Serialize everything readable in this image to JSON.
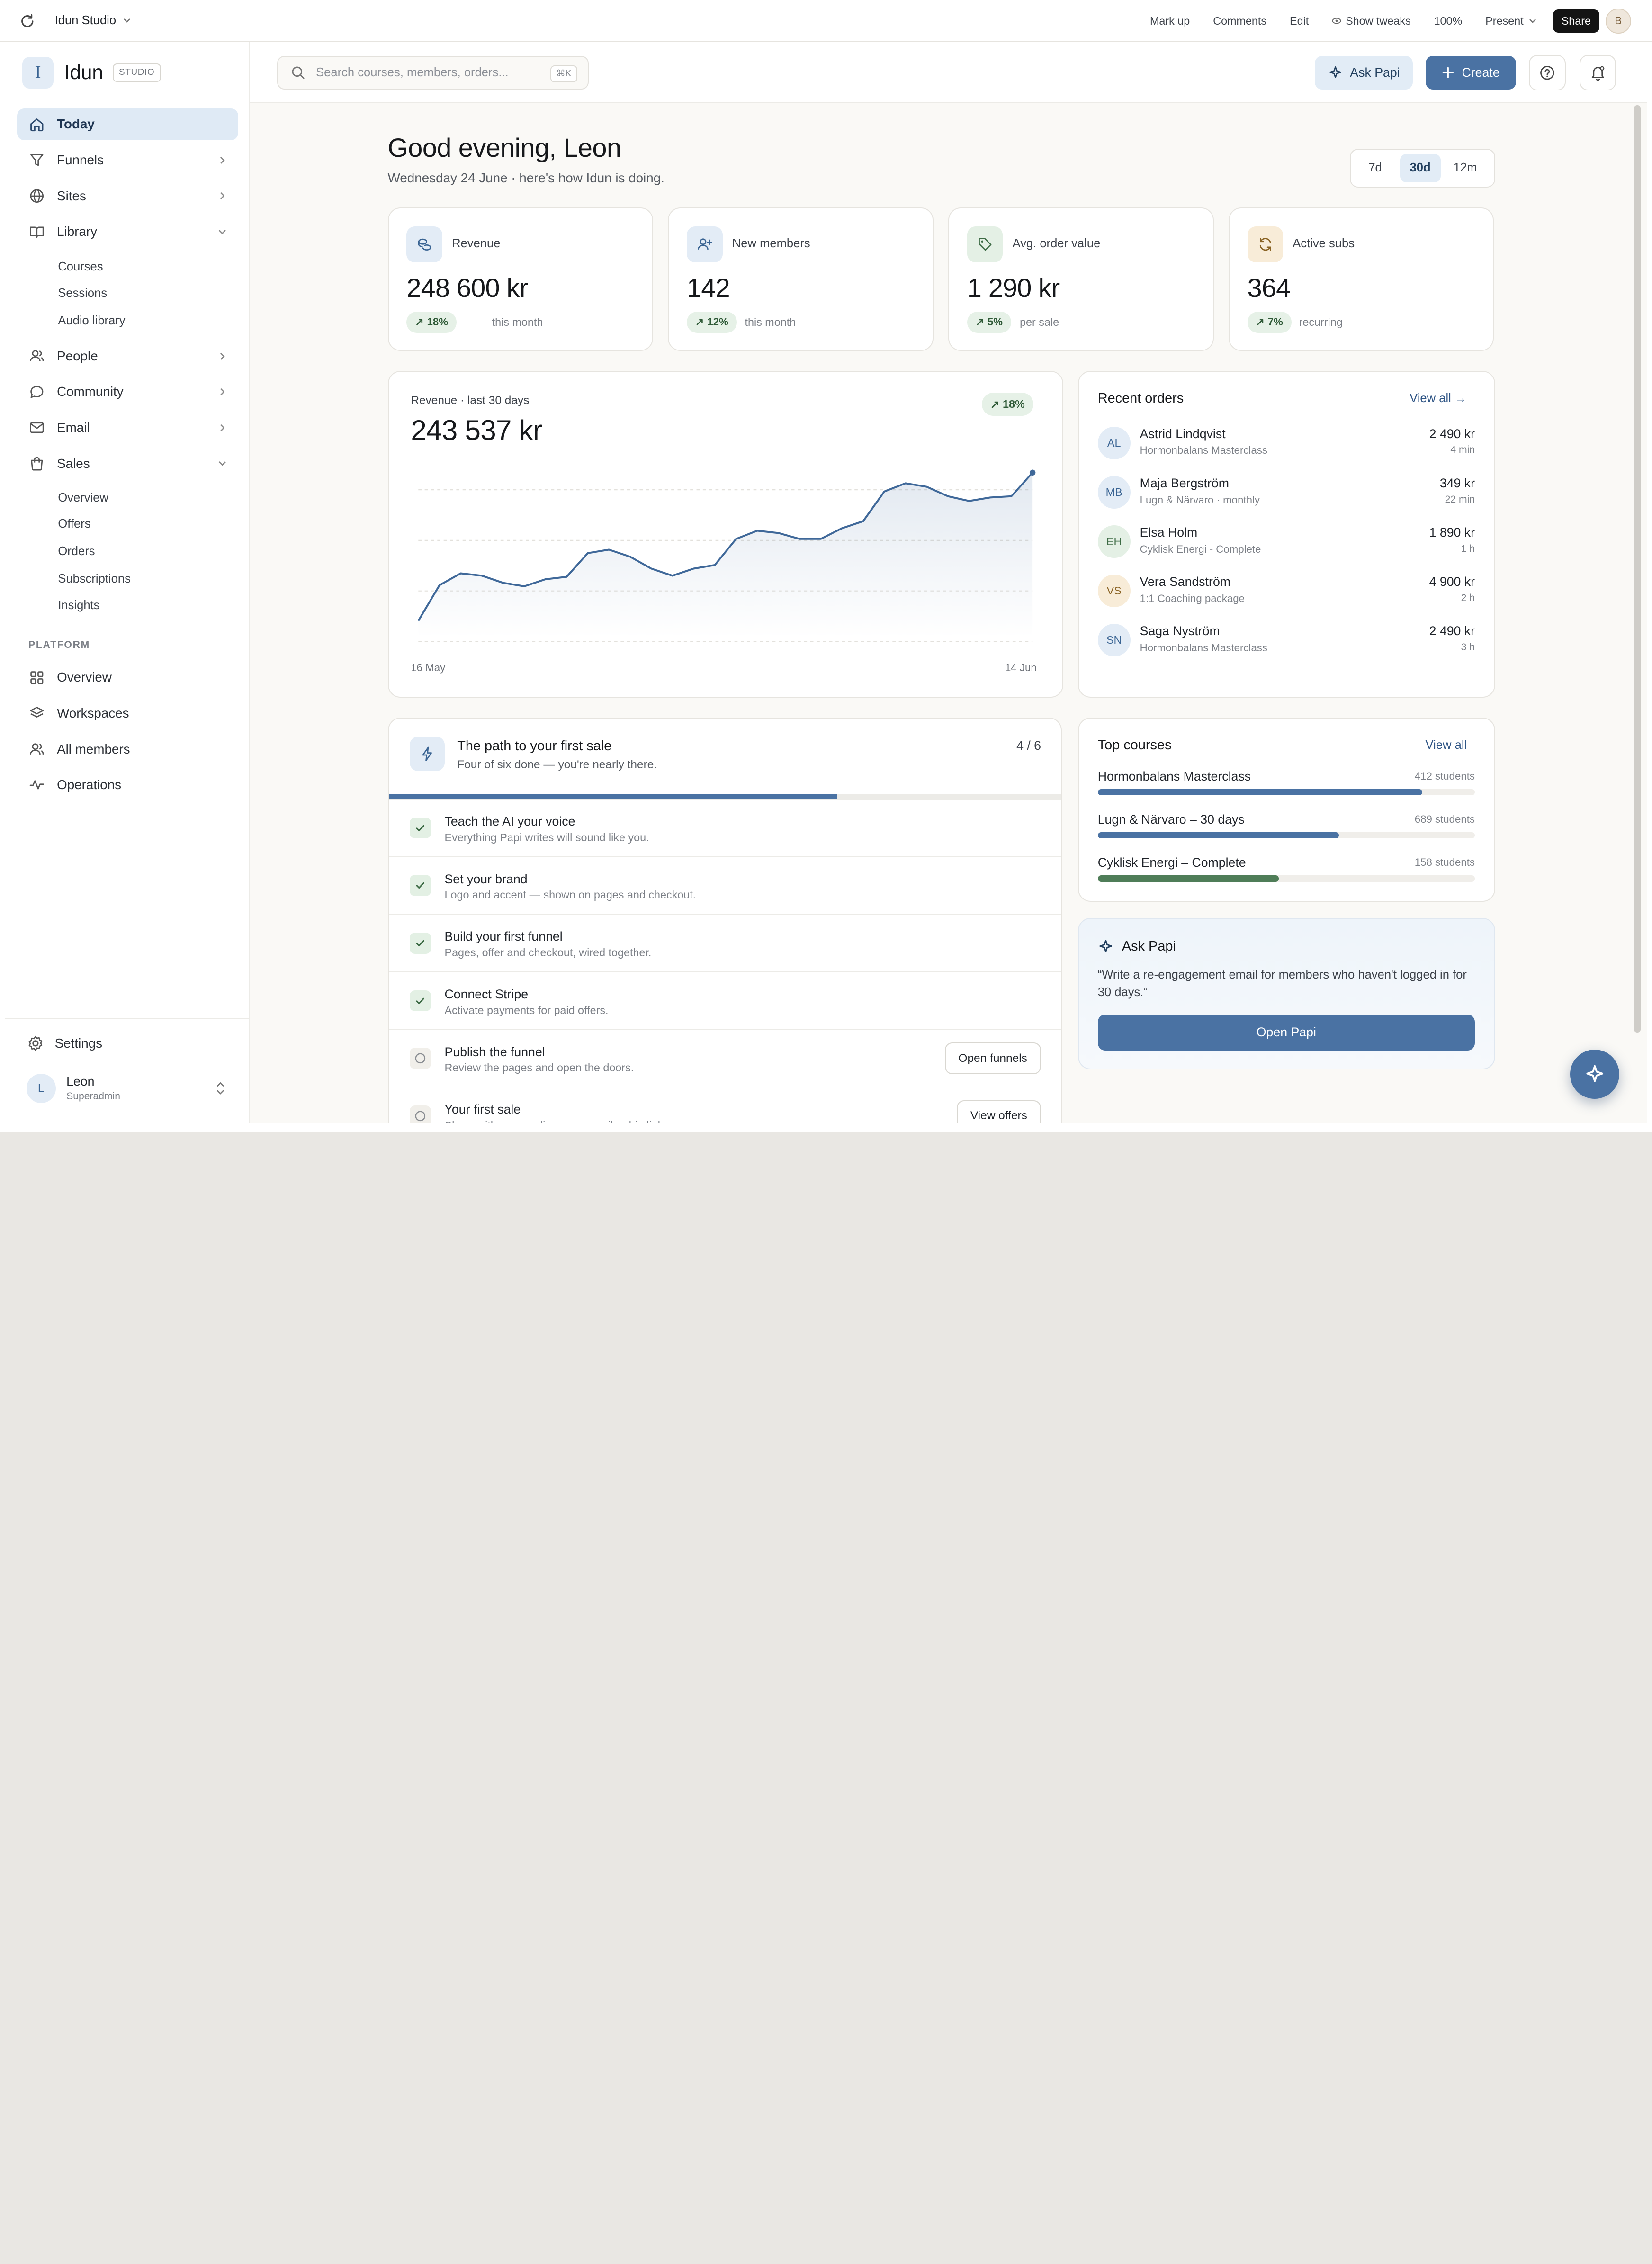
{
  "app": {
    "project": "Idun Studio"
  },
  "toolbar": {
    "items": [
      "Mark up",
      "Comments",
      "Edit",
      "Show tweaks",
      "100%",
      "Present"
    ],
    "share": "Share",
    "user_initial": "B"
  },
  "brand": {
    "logo": "I",
    "name": "Idun",
    "tag": "STUDIO"
  },
  "nav": {
    "today": "Today",
    "funnels": "Funnels",
    "sites": "Sites",
    "library": "Library",
    "library_sub": [
      "Courses",
      "Sessions",
      "Audio library"
    ],
    "people": "People",
    "community": "Community",
    "email": "Email",
    "sales": "Sales",
    "sales_sub": [
      "Overview",
      "Offers",
      "Orders",
      "Subscriptions",
      "Insights"
    ],
    "platform_label": "PLATFORM",
    "platform": [
      "Overview",
      "Workspaces",
      "All members",
      "Operations"
    ],
    "settings": "Settings"
  },
  "user": {
    "initial": "L",
    "name": "Leon",
    "role": "Superadmin"
  },
  "header": {
    "search_placeholder": "Search courses, members, orders...",
    "search_kbd": "⌘K",
    "ask": "Ask Papi",
    "create": "Create"
  },
  "greeting": {
    "title": "Good evening, Leon",
    "subtitle": "Wednesday 24 June · here's how Idun is doing."
  },
  "range": {
    "options": [
      "7d",
      "30d",
      "12m"
    ],
    "selected": "30d"
  },
  "stats": [
    {
      "label": "Revenue",
      "value": "248 600 kr",
      "delta": "18%",
      "note": "this month",
      "icon": "coins-icon"
    },
    {
      "label": "New members",
      "value": "142",
      "delta": "12%",
      "note": "this month",
      "icon": "user-plus-icon"
    },
    {
      "label": "Avg. order value",
      "value": "1 290 kr",
      "delta": "5%",
      "note": "per sale",
      "icon": "tag-icon"
    },
    {
      "label": "Active subs",
      "value": "364",
      "delta": "7%",
      "note": "recurring",
      "icon": "refresh-icon"
    }
  ],
  "chart_data": {
    "type": "area",
    "title": "Revenue · last 30 days",
    "total": "243 537 kr",
    "delta": "18%",
    "x_start": "16 May",
    "x_end": "14 Jun",
    "values": [
      5200,
      6700,
      7200,
      7100,
      6800,
      6650,
      6950,
      7050,
      8050,
      8200,
      7900,
      7400,
      7100,
      7400,
      7550,
      8650,
      9000,
      8900,
      8650,
      8650,
      9100,
      9400,
      10650,
      11000,
      10850,
      10450,
      10250,
      10400,
      10450,
      11450
    ],
    "ylim": [
      4500,
      12500
    ],
    "grid": true
  },
  "orders": {
    "title": "Recent orders",
    "view_all": "View all →",
    "items": [
      {
        "initials": "AL",
        "name": "Astrid Lindqvist",
        "product": "Hormonbalans Masterclass",
        "amount": "2 490 kr",
        "time": "4 min",
        "bg": "#e3ecf6",
        "fg": "#3a6493"
      },
      {
        "initials": "MB",
        "name": "Maja Bergström",
        "product": "Lugn & Närvaro · monthly",
        "amount": "349 kr",
        "time": "22 min",
        "bg": "#e3ecf6",
        "fg": "#3a6493"
      },
      {
        "initials": "EH",
        "name": "Elsa Holm",
        "product": "Cyklisk Energi - Complete",
        "amount": "1 890 kr",
        "time": "1 h",
        "bg": "#e4f0e5",
        "fg": "#3d6b45"
      },
      {
        "initials": "VS",
        "name": "Vera Sandström",
        "product": "1:1 Coaching package",
        "amount": "4 900 kr",
        "time": "2 h",
        "bg": "#f8ecd8",
        "fg": "#8a6324"
      },
      {
        "initials": "SN",
        "name": "Saga Nyström",
        "product": "Hormonbalans Masterclass",
        "amount": "2 490 kr",
        "time": "3 h",
        "bg": "#e3ecf6",
        "fg": "#3a6493"
      }
    ]
  },
  "path": {
    "title": "The path to your first sale",
    "subtitle": "Four of six done — you're nearly there.",
    "count": "4 / 6",
    "progress": 0.6667,
    "steps": [
      {
        "title": "Teach the AI your voice",
        "desc": "Everything Papi writes will sound like you.",
        "done": true,
        "action": ""
      },
      {
        "title": "Set your brand",
        "desc": "Logo and accent — shown on pages and checkout.",
        "done": true,
        "action": ""
      },
      {
        "title": "Build your first funnel",
        "desc": "Pages, offer and checkout, wired together.",
        "done": true,
        "action": ""
      },
      {
        "title": "Connect Stripe",
        "desc": "Activate payments for paid offers.",
        "done": true,
        "action": ""
      },
      {
        "title": "Publish the funnel",
        "desc": "Review the pages and open the doors.",
        "done": false,
        "action": "Open funnels"
      },
      {
        "title": "Your first sale",
        "desc": "Share with your audience — email or bio link.",
        "done": false,
        "action": "View offers"
      }
    ]
  },
  "courses": {
    "title": "Top courses",
    "view_all": "View all",
    "items": [
      {
        "name": "Hormonbalans Masterclass",
        "students": "412 students",
        "fill": 0.86,
        "color": "#4a72a3"
      },
      {
        "name": "Lugn & Närvaro – 30 days",
        "students": "689 students",
        "fill": 0.64,
        "color": "#4a72a3"
      },
      {
        "name": "Cyklisk Energi – Complete",
        "students": "158 students",
        "fill": 0.48,
        "color": "#4f7d58"
      }
    ]
  },
  "papi": {
    "title": "Ask Papi",
    "quote": "“Write a re-engagement email for members who haven't logged in for 30 days.”",
    "button": "Open Papi"
  }
}
